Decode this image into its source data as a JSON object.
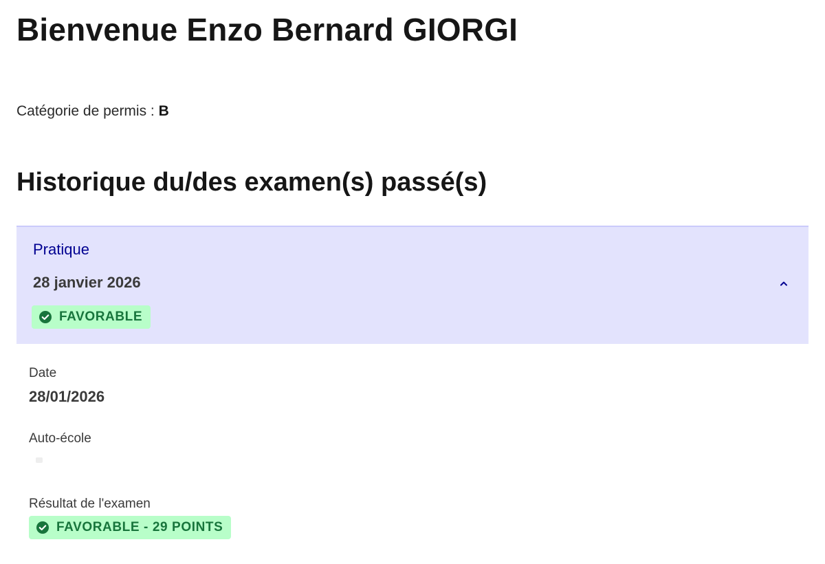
{
  "header": {
    "welcome": "Bienvenue Enzo Bernard GIORGI"
  },
  "permit": {
    "label": "Catégorie de permis :",
    "value": "B"
  },
  "history": {
    "title": "Historique du/des examen(s) passé(s)"
  },
  "exam": {
    "type": "Pratique",
    "date_long": "28 janvier 2026",
    "status_badge": "FAVORABLE",
    "expanded": true,
    "colors": {
      "header_bg": "#e3e3fd",
      "type_text": "#000091",
      "badge_bg": "#b8fec9",
      "badge_text": "#18753c"
    },
    "details": {
      "date_label": "Date",
      "date_value": "28/01/2026",
      "school_label": "Auto-école",
      "result_label": "Résultat de l'examen",
      "result_badge": "FAVORABLE - 29 POINTS"
    },
    "icons": {
      "status": "check-circle-icon",
      "toggle": "chevron-up-icon"
    }
  }
}
